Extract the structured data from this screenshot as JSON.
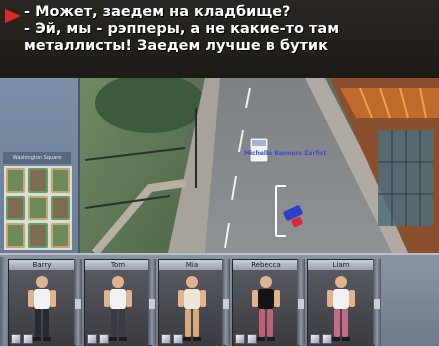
{
  "caption": {
    "lines": [
      "- Может, заедем на кладбище?",
      "- Эй, мы - рэпперы, а не какие-то там",
      "металлисты! Заедем лучше в бутик"
    ]
  },
  "game": {
    "minimap_label": "Washington Square",
    "player_tag": "Michelle Banners Zarfist",
    "characters": [
      {
        "name": "Barry",
        "shirt": "#f2f2f2",
        "pants": "#272a33"
      },
      {
        "name": "Tom",
        "shirt": "#f2f2f2",
        "pants": "#3a3b43"
      },
      {
        "name": "Mia",
        "shirt": "#ece6d8",
        "pants": "#d9a87a"
      },
      {
        "name": "Rebecca",
        "shirt": "#141414",
        "pants": "#c15f77"
      },
      {
        "name": "Liam",
        "shirt": "#f2f2f2",
        "pants": "#c46c85"
      }
    ]
  }
}
